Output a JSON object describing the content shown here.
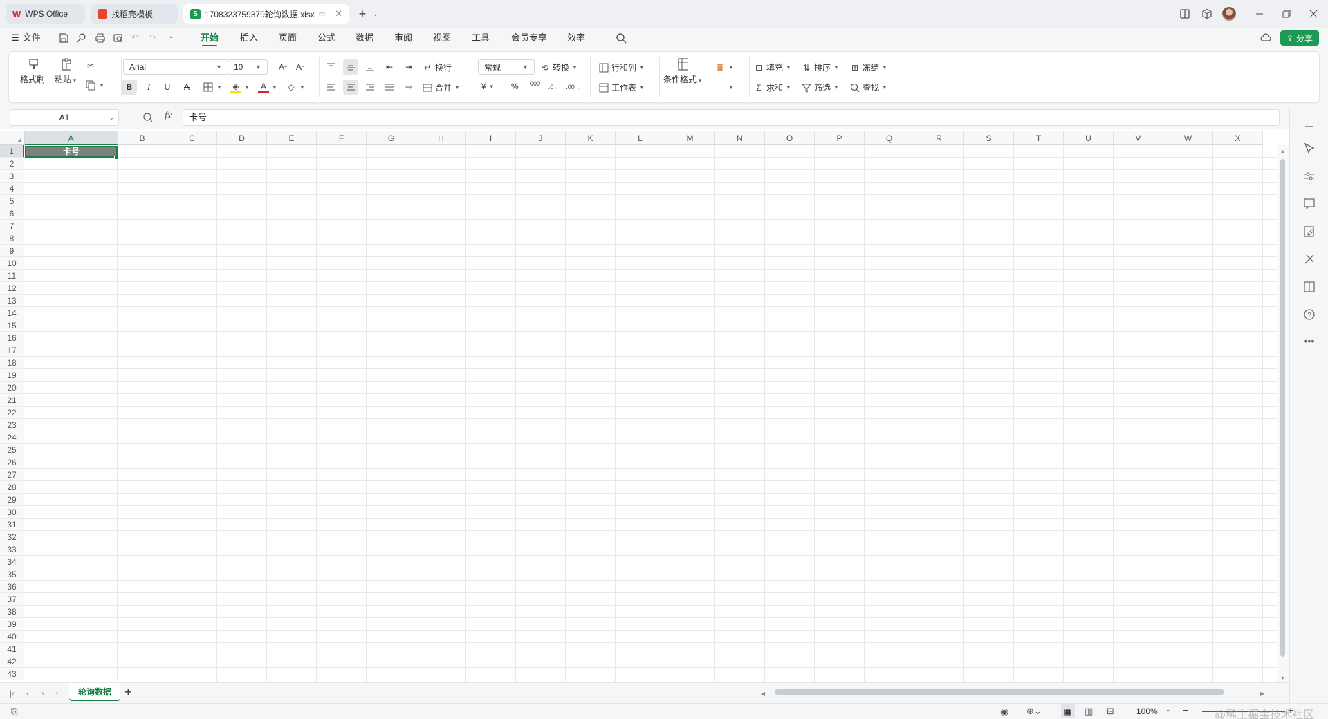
{
  "tabs": [
    {
      "label": "WPS Office",
      "icon": "wps-logo-icon"
    },
    {
      "label": "找稻壳模板",
      "icon": "docer-icon"
    },
    {
      "label": "170832375937​9轮询数据.xlsx",
      "icon": "sheet-s-icon",
      "active": true
    }
  ],
  "menu": {
    "file_label": "文件",
    "tabs": [
      "开始",
      "插入",
      "页面",
      "公式",
      "数据",
      "审阅",
      "视图",
      "工具",
      "会员专享",
      "效率"
    ],
    "active_tab": "开始",
    "share_label": "分享"
  },
  "ribbon": {
    "format_painter": "格式刷",
    "paste": "粘贴",
    "font_name": "Arial",
    "font_size": "10",
    "wrap": "换行",
    "merge": "合并",
    "number_format": "常规",
    "convert": "转换",
    "row_col": "行和列",
    "worksheet": "工作表",
    "cond_format": "条件格式",
    "fill": "填充",
    "sort": "排序",
    "freeze": "冻结",
    "sum": "求和",
    "filter": "筛选",
    "find": "查找",
    "currency_symbol": "¥",
    "percent_symbol": "%",
    "thousands_symbol": "000"
  },
  "formula_bar": {
    "cell_ref": "A1",
    "fx_label": "fx",
    "content": "卡号"
  },
  "sheet": {
    "columns": [
      "A",
      "B",
      "C",
      "D",
      "E",
      "F",
      "G",
      "H",
      "I",
      "J",
      "K",
      "L",
      "M",
      "N",
      "O",
      "P",
      "Q",
      "R",
      "S",
      "T",
      "U",
      "V",
      "W",
      "X"
    ],
    "selected_column": "A",
    "selected_row": 1,
    "rows": 43,
    "cells": {
      "A1": "卡号"
    }
  },
  "sheet_tabs": {
    "active": "轮询数据",
    "add_label": "+"
  },
  "status": {
    "zoom": "100%"
  },
  "watermark": "@稀土掘金技术社区",
  "colors": {
    "accent": "#1a7f45",
    "selected_cell_bg": "#7f7f7f"
  }
}
